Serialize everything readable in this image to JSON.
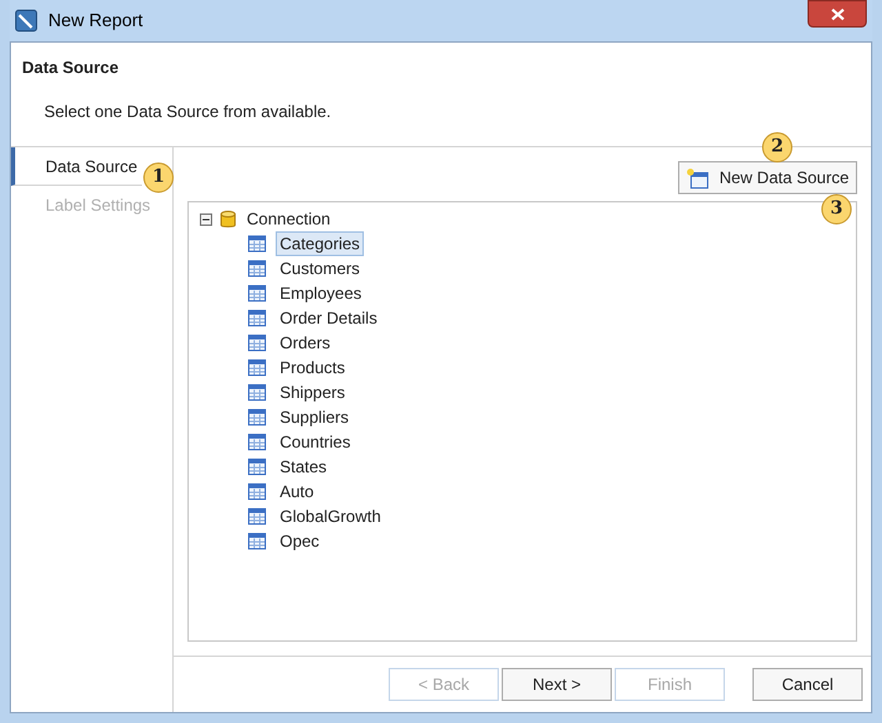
{
  "window": {
    "title": "New Report"
  },
  "header": {
    "title": "Data Source",
    "subtitle": "Select one Data Source from available."
  },
  "steps": [
    {
      "label": "Data Source",
      "selected": true,
      "disabled": false
    },
    {
      "label": "Label Settings",
      "selected": false,
      "disabled": true
    }
  ],
  "new_data_source_button": "New Data Source",
  "tree": {
    "label": "Connection",
    "expanded": true,
    "children": [
      {
        "label": "Categories",
        "selected": true
      },
      {
        "label": "Customers",
        "selected": false
      },
      {
        "label": "Employees",
        "selected": false
      },
      {
        "label": "Order Details",
        "selected": false
      },
      {
        "label": "Orders",
        "selected": false
      },
      {
        "label": "Products",
        "selected": false
      },
      {
        "label": "Shippers",
        "selected": false
      },
      {
        "label": "Suppliers",
        "selected": false
      },
      {
        "label": "Countries",
        "selected": false
      },
      {
        "label": "States",
        "selected": false
      },
      {
        "label": "Auto",
        "selected": false
      },
      {
        "label": "GlobalGrowth",
        "selected": false
      },
      {
        "label": "Opec",
        "selected": false
      }
    ]
  },
  "callouts": [
    "1",
    "2",
    "3"
  ],
  "buttons": [
    {
      "label": "< Back",
      "disabled": true
    },
    {
      "label": "Next >",
      "disabled": false
    },
    {
      "label": "Finish",
      "disabled": true
    },
    {
      "label": "Cancel",
      "disabled": false
    }
  ]
}
